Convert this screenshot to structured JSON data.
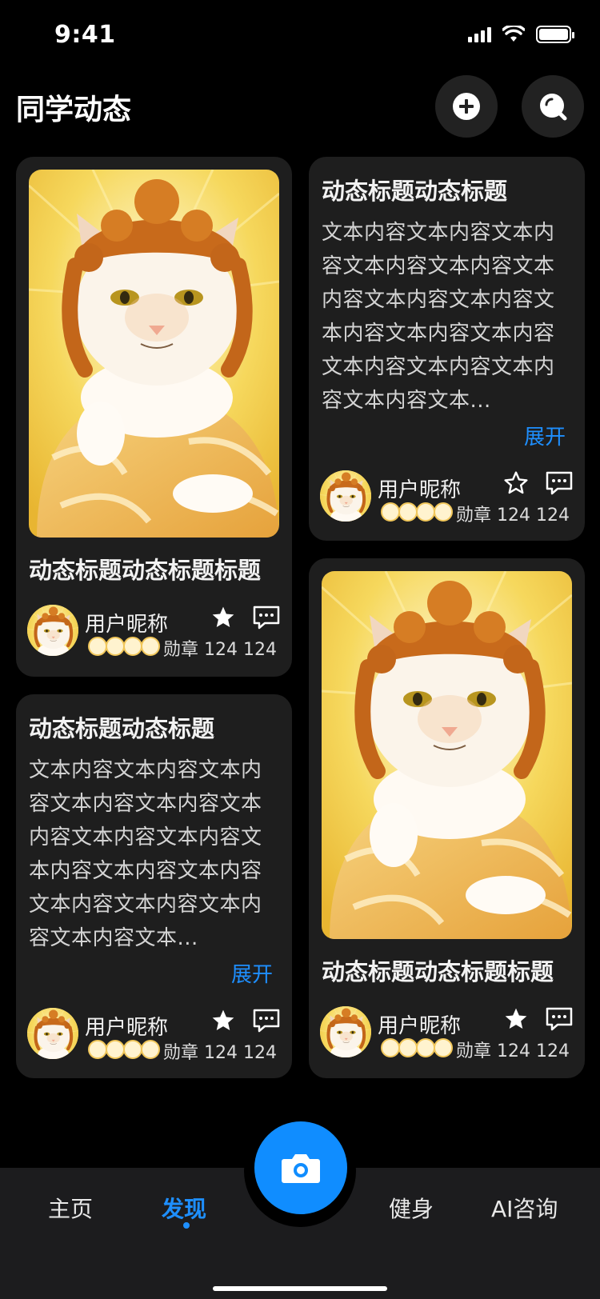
{
  "status_bar": {
    "time": "9:41"
  },
  "header": {
    "title": "同学动态",
    "add_button_icon": "plus-circle-icon",
    "search_button_icon": "search-icon"
  },
  "posts": [
    {
      "title": "动态标题动态标题标题",
      "author": "用户昵称",
      "medal_text": "勋章 124 124",
      "favorited": true,
      "has_image": true
    },
    {
      "title": "动态标题动态标题",
      "body": "文本内容文本内容文本内容文本内容文本内容文本内容文本内容文本内容文本内容文本内容文本内容文本内容文本内容文本内容文本内容文本...",
      "expand": "展开",
      "author": "用户昵称",
      "medal_text": "勋章 124 124",
      "favorited": false
    },
    {
      "title": "动态标题动态标题",
      "body": "文本内容文本内容文本内容文本内容文本内容文本内容文本内容文本内容文本内容文本内容文本内容文本内容文本内容文本内容文本内容文本...",
      "expand": "展开",
      "author": "用户昵称",
      "medal_text": "勋章 124 124",
      "favorited": true
    },
    {
      "title": "动态标题动态标题标题",
      "author": "用户昵称",
      "medal_text": "勋章 124 124",
      "favorited": true,
      "has_image": true
    }
  ],
  "tab_bar": {
    "tabs": [
      {
        "label": "主页",
        "active": false
      },
      {
        "label": "发现",
        "active": true
      },
      {
        "label": "健身",
        "active": false
      },
      {
        "label": "AI咨询",
        "active": false
      }
    ],
    "center_icon": "camera-icon"
  },
  "colors": {
    "accent": "#108dff",
    "card": "#1e1e1e",
    "background": "#000000"
  }
}
